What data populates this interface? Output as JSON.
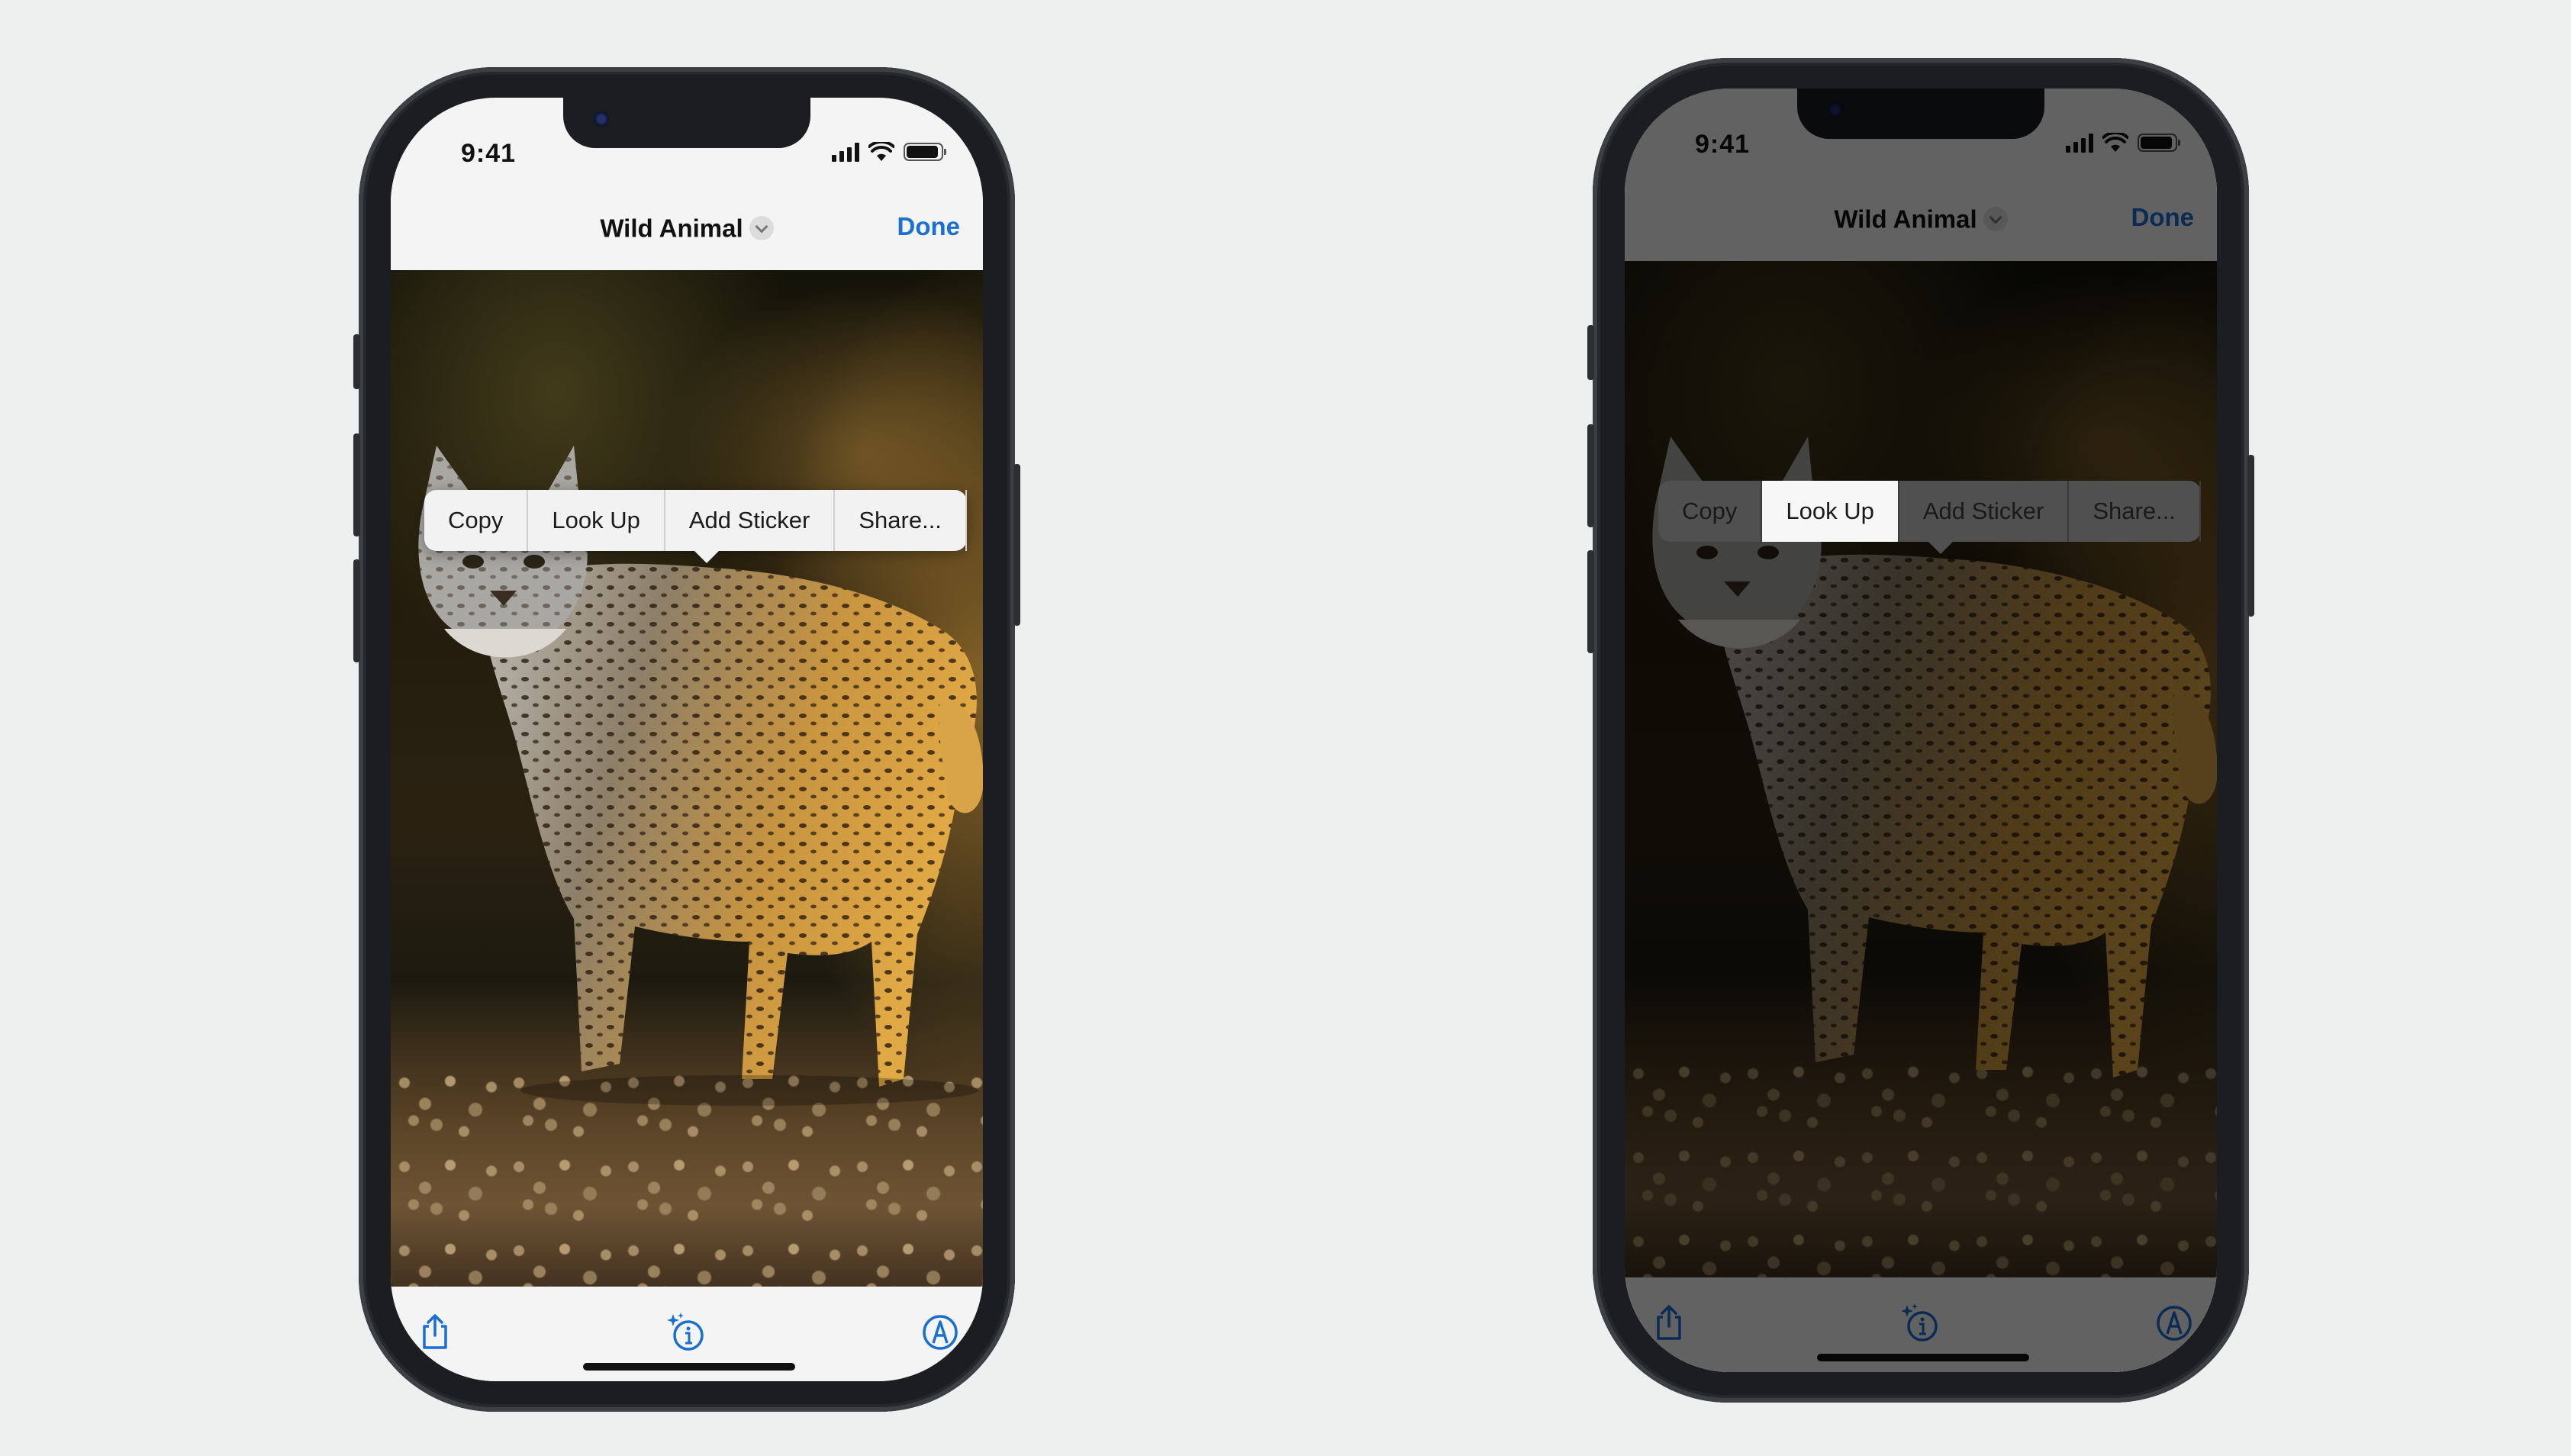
{
  "status_bar": {
    "time": "9:41"
  },
  "nav": {
    "title": "Wild Animal",
    "done_label": "Done"
  },
  "context_menu": {
    "items": [
      "Copy",
      "Look Up",
      "Add Sticker",
      "Share..."
    ],
    "selected_right": "Look Up"
  },
  "toolbar": {
    "icons": [
      "share-icon",
      "visual-look-up-info-icon",
      "markup-icon"
    ],
    "accent_color": "#1a6fd2"
  }
}
